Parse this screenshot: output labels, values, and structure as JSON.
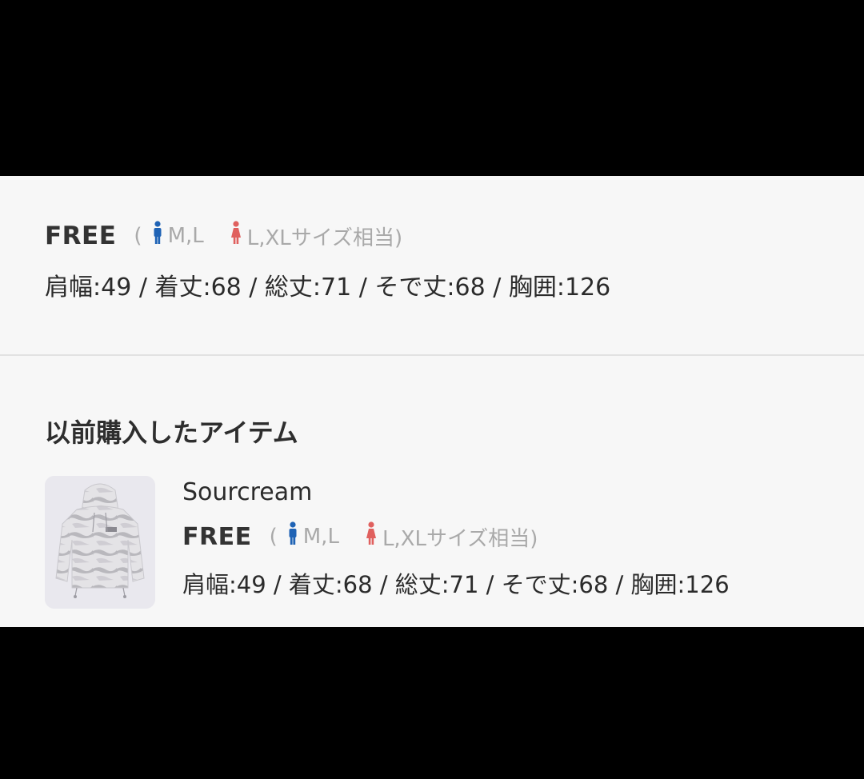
{
  "current_size": {
    "size_label": "FREE",
    "paren_open": "(",
    "men_fit": "M,L",
    "women_fit": "L,XLサイズ相当)",
    "measurements": "肩幅:49 / 着丈:68 / 総丈:71 / そで丈:68 / 胸囲:126"
  },
  "previous_items": {
    "title": "以前購入したアイテム",
    "items": [
      {
        "brand": "Sourcream",
        "size_label": "FREE",
        "paren_open": "(",
        "men_fit": "M,L",
        "women_fit": "L,XLサイズ相当)",
        "measurements": "肩幅:49 / 着丈:68 / 総丈:71 / そで丈:68 / 胸囲:126",
        "image_icon": "hoodie-thumbnail"
      }
    ]
  },
  "colors": {
    "male_icon": "#1f63b5",
    "female_icon": "#e0605e",
    "muted_text": "#a9a9a9",
    "panel_bg": "#f7f7f7"
  },
  "icons": {
    "male": "male-figure-icon",
    "female": "female-figure-icon"
  }
}
